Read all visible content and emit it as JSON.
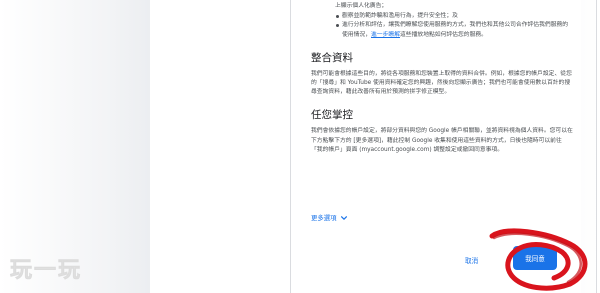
{
  "dialog": {
    "intro_line": "上顯示個人化廣告；",
    "bullets": [
      {
        "text": "觀察並防範詐騙和濫用行為，提升安全性；及"
      },
      {
        "text_before": "進行分析和評估，讓我們瞭解您使用服務的方式，我們也和其他公司合作評估我們服務的使用情況，",
        "link": "進一步瞭解",
        "text_after": "這些播放地點如何評估您的服務。"
      }
    ],
    "sections": [
      {
        "title": "整合資料",
        "body": "我們可能會根據這些目的，將從各項服務和您裝置上取得的資料合併。例如，根據您的帳戶設定、從您的「搜尋」和 YouTube 使用資料確定您的興趣，然後向您顯示廣告；我們也可能會使用數以百計的搜尋查詢資料，藉此改善所有用於預測的拼字修正模型。"
      },
      {
        "title": "任您掌控",
        "body": "我們會依據您的帳戶設定，將部分資料與您的 Google 帳戶相關聯，並將資料視為個人資料。您可以在下方點擊下方的 [更多選項]，藉此控制 Google 收集和使用這些資料的方式，日後也隨時可以前往「我的帳戶」頁面 (myaccount.google.com) 調整設定或撤回同意事項。"
      }
    ],
    "more_options_label": "更多選項",
    "cancel_label": "取消",
    "agree_label": "我同意"
  },
  "watermark": {
    "text": "玩一玩"
  },
  "icons": {
    "more_options": "chevron-down-icon"
  },
  "colors": {
    "accent": "#1a73e8",
    "annotation": "#d9141d",
    "watermark": "#e9e9e9"
  }
}
